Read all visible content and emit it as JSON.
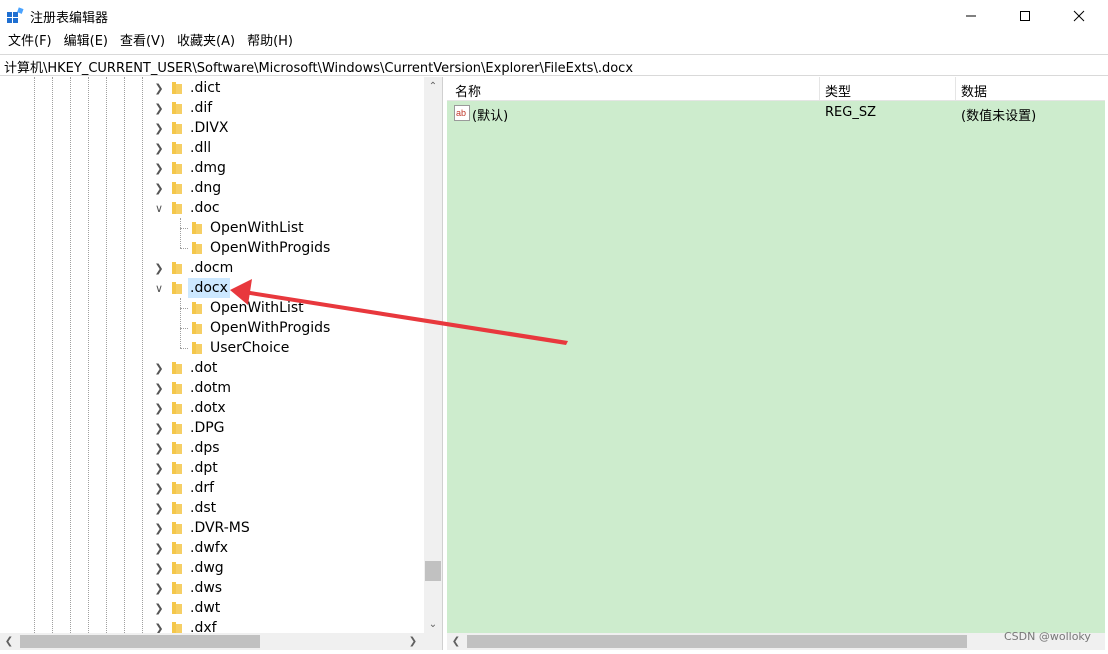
{
  "window": {
    "title": "注册表编辑器"
  },
  "menu": [
    "文件(F)",
    "编辑(E)",
    "查看(V)",
    "收藏夹(A)",
    "帮助(H)"
  ],
  "address": "计算机\\HKEY_CURRENT_USER\\Software\\Microsoft\\Windows\\CurrentVersion\\Explorer\\FileExts\\.docx",
  "tree": {
    "items": [
      {
        "label": ".dict",
        "state": "collapsed",
        "level": 0
      },
      {
        "label": ".dif",
        "state": "collapsed",
        "level": 0
      },
      {
        "label": ".DIVX",
        "state": "collapsed",
        "level": 0
      },
      {
        "label": ".dll",
        "state": "collapsed",
        "level": 0
      },
      {
        "label": ".dmg",
        "state": "collapsed",
        "level": 0
      },
      {
        "label": ".dng",
        "state": "collapsed",
        "level": 0
      },
      {
        "label": ".doc",
        "state": "expanded",
        "level": 0
      },
      {
        "label": "OpenWithList",
        "state": "leaf",
        "level": 1
      },
      {
        "label": "OpenWithProgids",
        "state": "leaf",
        "level": 1
      },
      {
        "label": ".docm",
        "state": "collapsed",
        "level": 0
      },
      {
        "label": ".docx",
        "state": "expanded",
        "level": 0,
        "selected": true
      },
      {
        "label": "OpenWithList",
        "state": "leaf",
        "level": 1
      },
      {
        "label": "OpenWithProgids",
        "state": "leaf",
        "level": 1
      },
      {
        "label": "UserChoice",
        "state": "leaf",
        "level": 1
      },
      {
        "label": ".dot",
        "state": "collapsed",
        "level": 0
      },
      {
        "label": ".dotm",
        "state": "collapsed",
        "level": 0
      },
      {
        "label": ".dotx",
        "state": "collapsed",
        "level": 0
      },
      {
        "label": ".DPG",
        "state": "collapsed",
        "level": 0
      },
      {
        "label": ".dps",
        "state": "collapsed",
        "level": 0
      },
      {
        "label": ".dpt",
        "state": "collapsed",
        "level": 0
      },
      {
        "label": ".drf",
        "state": "collapsed",
        "level": 0
      },
      {
        "label": ".dst",
        "state": "collapsed",
        "level": 0
      },
      {
        "label": ".DVR-MS",
        "state": "collapsed",
        "level": 0
      },
      {
        "label": ".dwfx",
        "state": "collapsed",
        "level": 0
      },
      {
        "label": ".dwg",
        "state": "collapsed",
        "level": 0
      },
      {
        "label": ".dws",
        "state": "collapsed",
        "level": 0
      },
      {
        "label": ".dwt",
        "state": "collapsed",
        "level": 0
      },
      {
        "label": ".dxf",
        "state": "collapsed",
        "level": 0
      }
    ]
  },
  "list": {
    "columns": [
      "名称",
      "类型",
      "数据"
    ],
    "rows": [
      {
        "name": "(默认)",
        "type": "REG_SZ",
        "data": "(数值未设置)"
      }
    ],
    "icon_text": "ab"
  },
  "watermark": "CSDN @wolloky",
  "colors": {
    "list_bg": "#cdeccd",
    "selection": "#cce8ff",
    "arrow": "#e8383d",
    "folder": "#f4c74a"
  }
}
